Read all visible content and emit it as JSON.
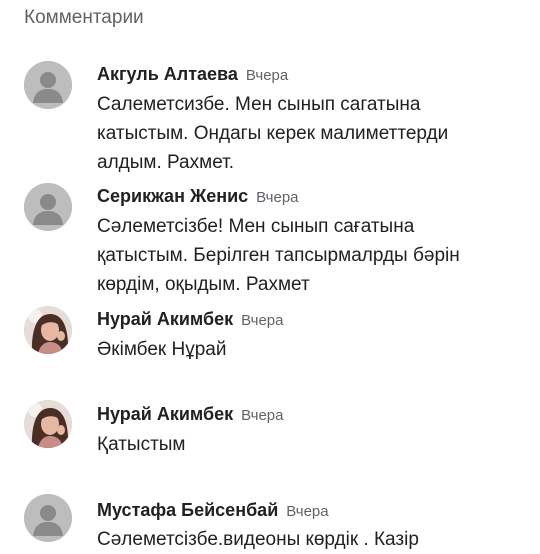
{
  "header": {
    "title": "Комментарии"
  },
  "comments": [
    {
      "avatar": "default-user-icon",
      "author": "Акгуль Алтаева",
      "time": "Вчера",
      "text": "Салеметсизбе. Мен сынып сагатына\nкатыстым. Ондагы керек малиметтерди\nалдым. Рахмет."
    },
    {
      "avatar": "default-user-icon",
      "author": "Серикжан Женис",
      "time": "Вчера",
      "text": "Сәлеметсізбе! Мен сынып сағатына\nқатыстым. Берілген тапсырмалрды бәрін\nкөрдім, оқыдым. Рахмет"
    },
    {
      "avatar": "user-photo",
      "author": "Нурай Акимбек",
      "time": "Вчера",
      "text": "Әкімбек Нұрай"
    },
    {
      "avatar": "user-photo",
      "author": "Нурай Акимбек",
      "time": "Вчера",
      "text": "Қатыстым"
    },
    {
      "avatar": "default-user-icon",
      "author": "Мустафа Бейсенбай",
      "time": "Вчера",
      "text": "Сәлеметсізбе.видеоны көрдік . Казір"
    }
  ]
}
